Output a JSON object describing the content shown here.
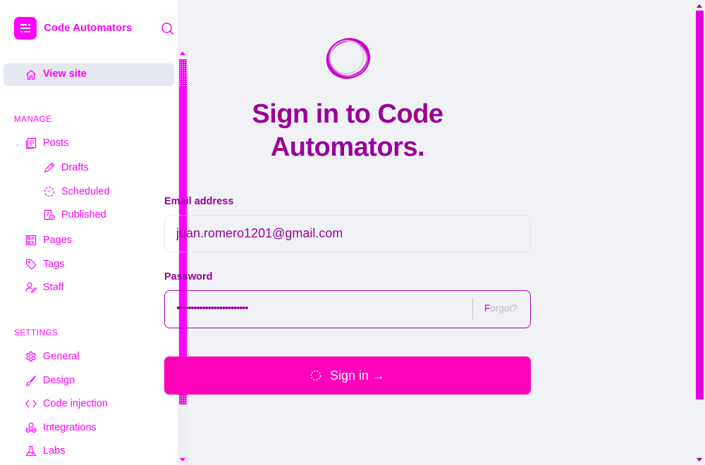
{
  "sidebar": {
    "brand": {
      "name": "Code Automators",
      "logo_icon": "settings-sliders-icon"
    },
    "search_icon": "search-icon",
    "view_site": {
      "label": "View site",
      "icon": "home-icon"
    },
    "manage": {
      "title": "MANAGE",
      "items": [
        {
          "label": "Posts",
          "icon": "posts-icon",
          "level": 1
        },
        {
          "label": "Drafts",
          "icon": "pencil-icon",
          "level": 2
        },
        {
          "label": "Scheduled",
          "icon": "clock-dashed-icon",
          "level": 2
        },
        {
          "label": "Published",
          "icon": "published-check-icon",
          "level": 2
        },
        {
          "label": "Pages",
          "icon": "pages-icon",
          "level": 1
        },
        {
          "label": "Tags",
          "icon": "tag-icon",
          "level": 1
        },
        {
          "label": "Staff",
          "icon": "staff-icon",
          "level": 1
        }
      ]
    },
    "settings": {
      "title": "SETTINGS",
      "items": [
        {
          "label": "General",
          "icon": "gear-icon"
        },
        {
          "label": "Design",
          "icon": "brush-icon"
        },
        {
          "label": "Code injection",
          "icon": "code-icon"
        },
        {
          "label": "Integrations",
          "icon": "integrations-icon"
        },
        {
          "label": "Labs",
          "icon": "flask-icon"
        }
      ]
    }
  },
  "main": {
    "logo_icon": "ring-logo-icon",
    "heading_line1": "Sign in to Code",
    "heading_line2": "Automators.",
    "form": {
      "email_label": "Email address",
      "email_value": "juan.romero1201@gmail.com",
      "password_label": "Password",
      "password_masked": "•••••••••••••••••••••••••",
      "forgot_label": "Forgot?",
      "signin_label": "Sign in →",
      "signin_state": "loading"
    }
  },
  "colors": {
    "sidebar_accent": "#ff00ff",
    "heading": "#990099",
    "button": "#ff00bb",
    "page_bg": "#f1f2f6",
    "active_item_bg": "#e5e8f0"
  }
}
